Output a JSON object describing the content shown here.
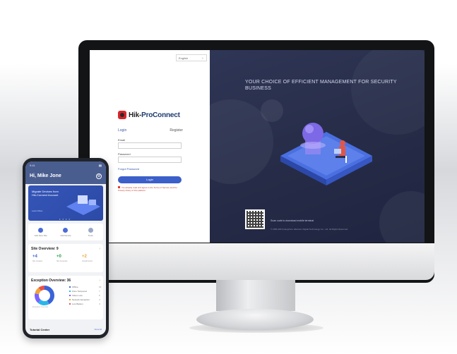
{
  "desktop": {
    "language": "English",
    "brand": {
      "name_part1": "Hik-",
      "name_part2": "ProConnect"
    },
    "tabs": {
      "login": "Login",
      "register": "Register"
    },
    "fields": {
      "email_label": "Email",
      "password_label": "Password"
    },
    "forgot_label": "Forgot Password",
    "login_button": "Login",
    "agreement": "I've already read and agree to the Terms of Service and the Privacy Policy of this platform.",
    "headline": "YOUR CHOICE OF EFFICIENT MANAGEMENT FOR SECURITY BUSINESS",
    "qr_caption": "Scan code to download mobile terminal",
    "copyright": "© 2006-2019 Hangzhou Hikvision Digital Technology Co., Ltd. All Rights Reserved."
  },
  "phone": {
    "time": "9:41",
    "greeting": "Hi, Mike Jone",
    "banner": {
      "text": "Migrate Devices from Hik-Connect Account",
      "link": "Learn More"
    },
    "actions": [
      {
        "label": "Add New Site",
        "icon": "site-icon"
      },
      {
        "label": "Add Device",
        "icon": "device-icon"
      },
      {
        "label": "Tools",
        "icon": "tools-icon"
      }
    ],
    "site_overview": {
      "title": "Site Overview: 9",
      "stats": [
        {
          "value": "4",
          "label": "Site Created",
          "color": "#3b63d9"
        },
        {
          "value": "0",
          "label": "Site Accepted",
          "color": "#27a046"
        },
        {
          "value": "2",
          "label": "Unauthorized",
          "color": "#f0a33a"
        }
      ]
    },
    "exception_overview": {
      "title": "Exception Overview: 36",
      "caption": "Exception Overview",
      "items": [
        {
          "label": "Offline",
          "count": "15",
          "color": "#3b63d9",
          "share": 0.42
        },
        {
          "label": "Zone Tampered",
          "count": "7",
          "color": "#28b6e8",
          "share": 0.19
        },
        {
          "label": "Video Loss",
          "count": "6",
          "color": "#7b61ff",
          "share": 0.17
        },
        {
          "label": "Network Exception",
          "count": "4",
          "color": "#f0a33a",
          "share": 0.11
        },
        {
          "label": "Low Battery",
          "count": "4",
          "color": "#e8534a",
          "share": 0.11
        }
      ]
    },
    "tutorial": {
      "title": "Tutorial Center",
      "view_all": "View All"
    }
  }
}
